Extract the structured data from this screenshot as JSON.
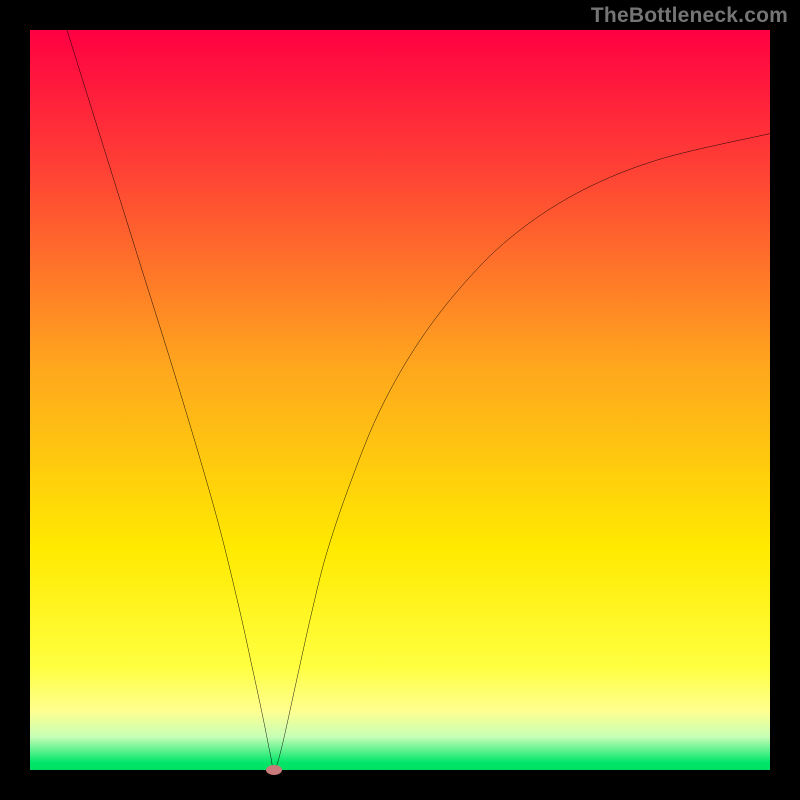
{
  "watermark": "TheBottleneck.com",
  "chart_data": {
    "type": "line",
    "title": "",
    "xlabel": "",
    "ylabel": "",
    "xlim": [
      0,
      100
    ],
    "ylim": [
      0,
      100
    ],
    "background_gradient": {
      "direction": "vertical",
      "stops": [
        {
          "pos": 0.0,
          "color": "#ff0042"
        },
        {
          "pos": 0.2,
          "color": "#ff4534"
        },
        {
          "pos": 0.45,
          "color": "#ffa51e"
        },
        {
          "pos": 0.7,
          "color": "#ffea00"
        },
        {
          "pos": 0.86,
          "color": "#ffff40"
        },
        {
          "pos": 0.92,
          "color": "#ffff90"
        },
        {
          "pos": 0.955,
          "color": "#c7ffb6"
        },
        {
          "pos": 0.99,
          "color": "#00e66a"
        },
        {
          "pos": 1.0,
          "color": "#00e060"
        }
      ]
    },
    "series": [
      {
        "name": "bottleneck-curve",
        "color": "#000000",
        "x": [
          5,
          10,
          15,
          20,
          25,
          28,
          30,
          31.5,
          32.5,
          33,
          34,
          36,
          38,
          40,
          43,
          47,
          52,
          58,
          65,
          74,
          85,
          100
        ],
        "y": [
          100,
          84,
          68,
          52,
          35,
          23,
          14,
          7,
          2,
          0,
          3,
          12,
          21,
          29,
          38,
          48,
          57,
          65,
          72,
          78,
          82.5,
          86
        ]
      }
    ],
    "marker": {
      "x": 33,
      "y": 0,
      "color": "#c97a7a",
      "label": "optimal-point"
    }
  }
}
